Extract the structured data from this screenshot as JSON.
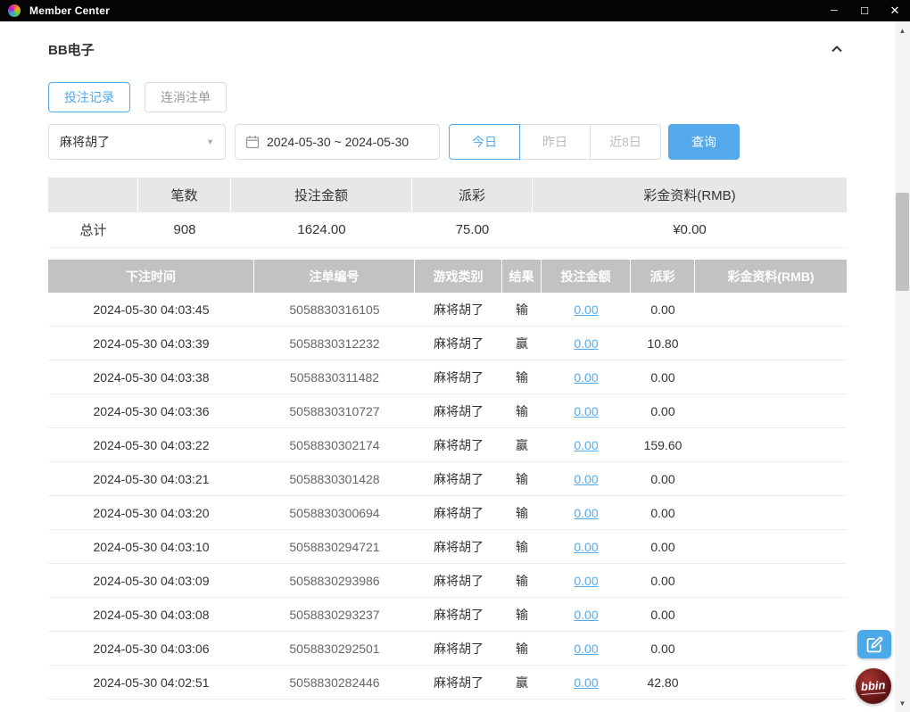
{
  "titlebar": {
    "title": "Member Center"
  },
  "icons": {
    "app": "pinwheel",
    "minimize": "─",
    "maximize": "☐",
    "close": "✕",
    "collapse": "chevron-up",
    "calendar": "calendar",
    "select_arrow": "▼",
    "scroll_up": "▲",
    "scroll_down": "▼",
    "edit": "pencil-square",
    "bbin_label": "bbin"
  },
  "colors": {
    "accent": "#54a9ea",
    "search_button_bg": "#54a9ea",
    "table_header_bg": "#c2c2c2",
    "summary_header_bg": "#e7e7e7",
    "titlebar_bg": "#040404",
    "link": "#54a9ea",
    "bbin_badge": "#5c1112"
  },
  "page": {
    "title": "BB电子"
  },
  "tabs": [
    {
      "label": "投注记录",
      "active": true
    },
    {
      "label": "连消注单",
      "active": false
    }
  ],
  "filters": {
    "game_select_value": "麻将胡了",
    "date_range": "2024-05-30 ~ 2024-05-30",
    "quick": [
      {
        "label": "今日",
        "active": true
      },
      {
        "label": "昨日",
        "active": false
      },
      {
        "label": "近8日",
        "active": false
      }
    ],
    "search_label": "查询"
  },
  "summary": {
    "headers": [
      "",
      "笔数",
      "投注金额",
      "派彩",
      "彩金资料(RMB)"
    ],
    "row": {
      "label": "总计",
      "count": "908",
      "bet_amount": "1624.00",
      "payout": "75.00",
      "bonus": "¥0.00"
    }
  },
  "table": {
    "headers": [
      "下注时间",
      "注单编号",
      "游戏类别",
      "结果",
      "投注金额",
      "派彩",
      "彩金资料(RMB)"
    ],
    "rows": [
      [
        "2024-05-30 04:03:45",
        "5058830316105",
        "麻将胡了",
        "输",
        "0.00",
        "0.00",
        ""
      ],
      [
        "2024-05-30 04:03:39",
        "5058830312232",
        "麻将胡了",
        "赢",
        "0.00",
        "10.80",
        ""
      ],
      [
        "2024-05-30 04:03:38",
        "5058830311482",
        "麻将胡了",
        "输",
        "0.00",
        "0.00",
        ""
      ],
      [
        "2024-05-30 04:03:36",
        "5058830310727",
        "麻将胡了",
        "输",
        "0.00",
        "0.00",
        ""
      ],
      [
        "2024-05-30 04:03:22",
        "5058830302174",
        "麻将胡了",
        "赢",
        "0.00",
        "159.60",
        ""
      ],
      [
        "2024-05-30 04:03:21",
        "5058830301428",
        "麻将胡了",
        "输",
        "0.00",
        "0.00",
        ""
      ],
      [
        "2024-05-30 04:03:20",
        "5058830300694",
        "麻将胡了",
        "输",
        "0.00",
        "0.00",
        ""
      ],
      [
        "2024-05-30 04:03:10",
        "5058830294721",
        "麻将胡了",
        "输",
        "0.00",
        "0.00",
        ""
      ],
      [
        "2024-05-30 04:03:09",
        "5058830293986",
        "麻将胡了",
        "输",
        "0.00",
        "0.00",
        ""
      ],
      [
        "2024-05-30 04:03:08",
        "5058830293237",
        "麻将胡了",
        "输",
        "0.00",
        "0.00",
        ""
      ],
      [
        "2024-05-30 04:03:06",
        "5058830292501",
        "麻将胡了",
        "输",
        "0.00",
        "0.00",
        ""
      ],
      [
        "2024-05-30 04:02:51",
        "5058830282446",
        "麻将胡了",
        "赢",
        "0.00",
        "42.80",
        ""
      ]
    ]
  }
}
